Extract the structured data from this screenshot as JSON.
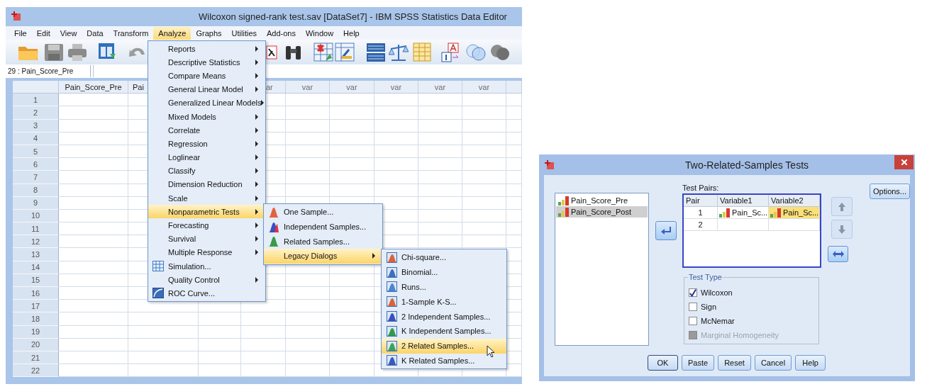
{
  "window": {
    "title": "Wilcoxon signed-rank test.sav [DataSet7] - IBM SPSS Statistics Data Editor"
  },
  "menu_bar": [
    {
      "label": "File",
      "selected": false
    },
    {
      "label": "Edit",
      "selected": false
    },
    {
      "label": "View",
      "selected": false
    },
    {
      "label": "Data",
      "selected": false
    },
    {
      "label": "Transform",
      "selected": false
    },
    {
      "label": "Analyze",
      "selected": true
    },
    {
      "label": "Graphs",
      "selected": false
    },
    {
      "label": "Utilities",
      "selected": false
    },
    {
      "label": "Add-ons",
      "selected": false
    },
    {
      "label": "Window",
      "selected": false
    },
    {
      "label": "Help",
      "selected": false
    }
  ],
  "cell_reference": "29 : Pain_Score_Pre",
  "grid": {
    "columns": [
      {
        "label": "Pain_Score_Pre",
        "kind": "full"
      },
      {
        "label": "Pai",
        "kind": "cut_right"
      },
      {
        "kind": "hidden"
      },
      {
        "label": "ar",
        "kind": "cut_left"
      },
      {
        "label": "var",
        "kind": "var"
      },
      {
        "label": "var",
        "kind": "var"
      },
      {
        "label": "var",
        "kind": "var"
      },
      {
        "label": "var",
        "kind": "var"
      },
      {
        "label": "var",
        "kind": "var"
      },
      {
        "kind": "hidden"
      }
    ],
    "rows": [
      "1",
      "2",
      "3",
      "4",
      "5",
      "6",
      "7",
      "8",
      "9",
      "10",
      "11",
      "12",
      "13",
      "14",
      "15",
      "16",
      "17",
      "18",
      "19",
      "20",
      "21",
      "22"
    ]
  },
  "analyze_menu": [
    {
      "label": "Reports",
      "kind": "submenu",
      "selected": false
    },
    {
      "label": "Descriptive Statistics",
      "kind": "submenu",
      "selected": false
    },
    {
      "label": "Compare Means",
      "kind": "submenu",
      "selected": false
    },
    {
      "label": "General Linear Model",
      "kind": "submenu",
      "selected": false
    },
    {
      "label": "Generalized Linear Models",
      "kind": "submenu",
      "selected": false
    },
    {
      "label": "Mixed Models",
      "kind": "submenu",
      "selected": false
    },
    {
      "label": "Correlate",
      "kind": "submenu",
      "selected": false
    },
    {
      "label": "Regression",
      "kind": "submenu",
      "selected": false
    },
    {
      "label": "Loglinear",
      "kind": "submenu",
      "selected": false
    },
    {
      "label": "Classify",
      "kind": "submenu",
      "selected": false
    },
    {
      "label": "Dimension Reduction",
      "kind": "submenu",
      "selected": false
    },
    {
      "label": "Scale",
      "kind": "submenu",
      "selected": false
    },
    {
      "label": "Nonparametric Tests",
      "kind": "submenu",
      "selected": true
    },
    {
      "label": "Forecasting",
      "kind": "submenu",
      "selected": false
    },
    {
      "label": "Survival",
      "kind": "submenu",
      "selected": false
    },
    {
      "label": "Multiple Response",
      "kind": "submenu",
      "selected": false
    },
    {
      "label": "Simulation...",
      "kind": "command",
      "selected": false
    },
    {
      "label": "Quality Control",
      "kind": "submenu",
      "selected": false
    },
    {
      "label": "ROC Curve...",
      "kind": "command",
      "selected": false
    }
  ],
  "nonparametric_menu": [
    {
      "label": "One Sample...",
      "kind": "command",
      "selected": false
    },
    {
      "label": "Independent Samples...",
      "kind": "command",
      "selected": false
    },
    {
      "label": "Related Samples...",
      "kind": "command",
      "selected": false
    },
    {
      "label": "Legacy Dialogs",
      "kind": "submenu",
      "selected": true
    }
  ],
  "legacy_menu": [
    {
      "label": "Chi-square...",
      "kind": "command",
      "selected": false
    },
    {
      "label": "Binomial...",
      "kind": "command",
      "selected": false
    },
    {
      "label": "Runs...",
      "kind": "command",
      "selected": false
    },
    {
      "label": "1-Sample K-S...",
      "kind": "command",
      "selected": false
    },
    {
      "label": "2 Independent Samples...",
      "kind": "command",
      "selected": false
    },
    {
      "label": "K Independent Samples...",
      "kind": "command",
      "selected": false
    },
    {
      "label": "2 Related Samples...",
      "kind": "command",
      "selected": true
    },
    {
      "label": "K Related Samples...",
      "kind": "command",
      "selected": false
    }
  ],
  "dialog": {
    "title": "Two-Related-Samples Tests",
    "variables": [
      {
        "label": "Pain_Score_Pre",
        "selected": false
      },
      {
        "label": "Pain_Score_Post",
        "selected": true
      }
    ],
    "test_pairs_label": "Test Pairs:",
    "pairs_columns": [
      "Pair",
      "Variable1",
      "Variable2"
    ],
    "pairs": [
      {
        "pair": "1",
        "cells": [
          {
            "text": "Pain_Sc...",
            "selected": false
          },
          {
            "text": "Pain_Sc...",
            "selected": true
          }
        ]
      },
      {
        "pair": "2",
        "cells": [
          {
            "selected": false
          },
          {
            "selected": false
          }
        ]
      }
    ],
    "side_buttons": [
      {
        "kind": "up",
        "disabled": true
      },
      {
        "kind": "down",
        "disabled": true
      },
      {
        "kind": "swap",
        "disabled": false
      }
    ],
    "options_button": "Options...",
    "test_type": {
      "title": "Test Type",
      "options": [
        {
          "label": "Wilcoxon",
          "checked": true,
          "disabled": false
        },
        {
          "label": "Sign",
          "checked": false,
          "disabled": false
        },
        {
          "label": "McNemar",
          "checked": false,
          "disabled": false
        },
        {
          "label": "Marginal Homogeneity",
          "checked": false,
          "disabled": true
        }
      ]
    },
    "buttons": [
      {
        "label": "OK",
        "default": true
      },
      {
        "label": "Paste",
        "default": false
      },
      {
        "label": "Reset",
        "default": false
      },
      {
        "label": "Cancel",
        "default": false
      },
      {
        "label": "Help",
        "default": false
      }
    ]
  }
}
